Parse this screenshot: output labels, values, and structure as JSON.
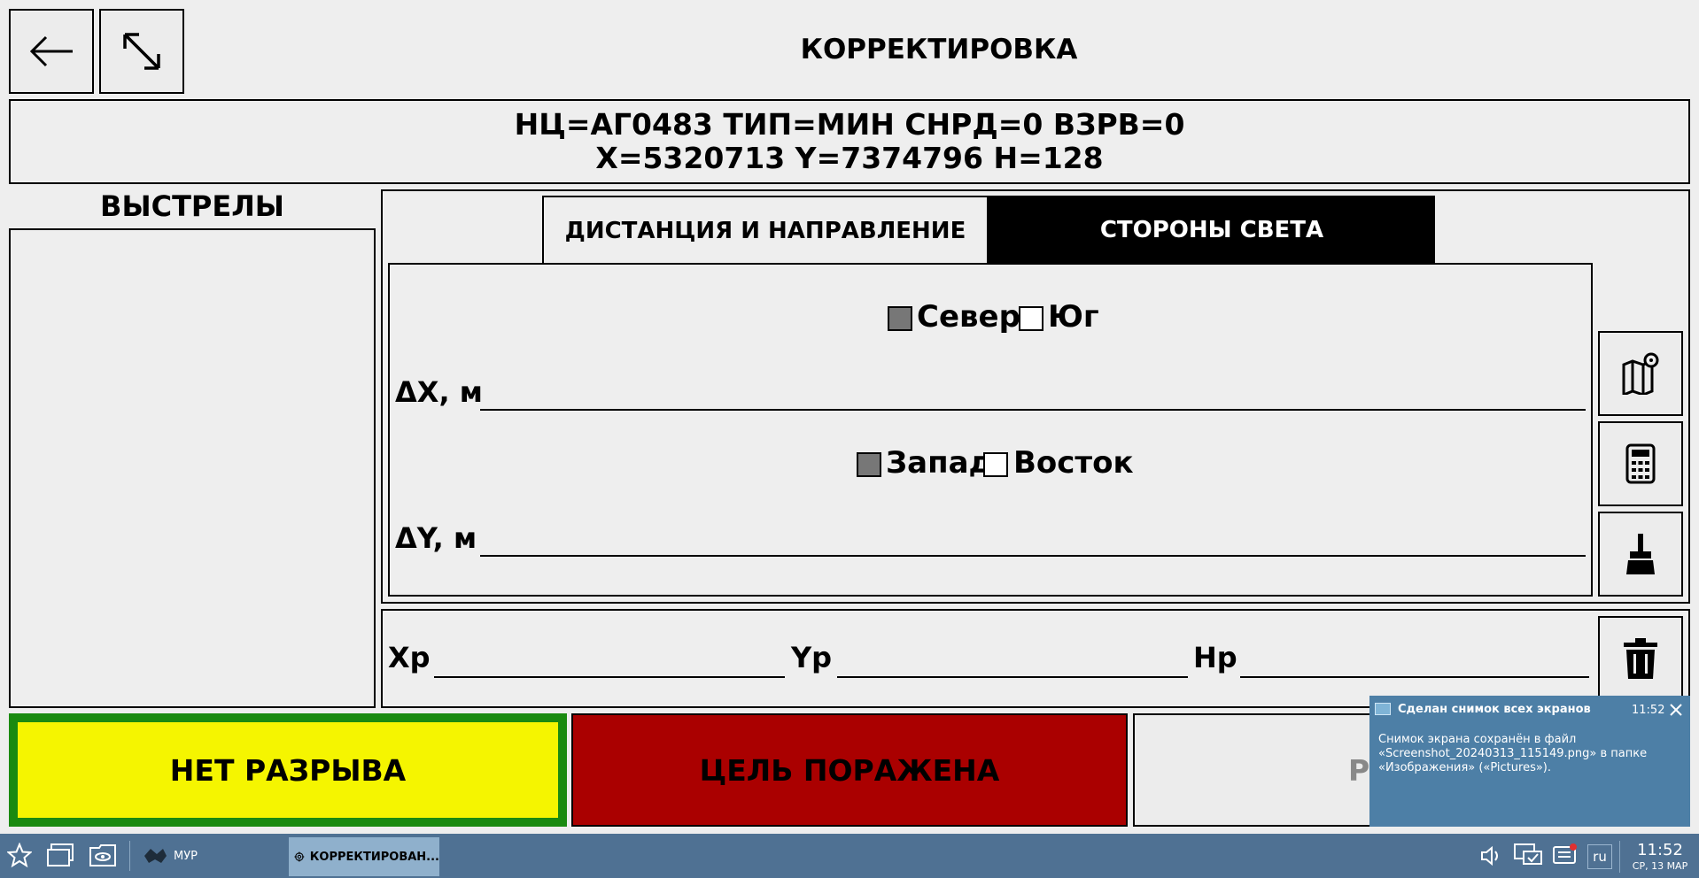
{
  "header": {
    "title": "КОРРЕКТИРОВКА"
  },
  "info": {
    "line1": "НЦ=АГ0483 ТИП=МИН СНРД=0 ВЗРВ=0",
    "line2": "X=5320713 Y=7374796 H=128"
  },
  "shots": {
    "title": "ВЫСТРЕЛЫ"
  },
  "tabs": [
    {
      "label": "ДИСТАНЦИЯ И НАПРАВЛЕНИЕ",
      "active": false
    },
    {
      "label": "СТОРОНЫ СВЕТА",
      "active": true
    }
  ],
  "compass": {
    "north_label": "Север",
    "north_checked": true,
    "south_label": "Юг",
    "south_checked": false,
    "dx_label": "ΔX, м",
    "west_label": "Запад",
    "west_checked": true,
    "east_label": "Восток",
    "east_checked": false,
    "dy_label": "ΔY, м"
  },
  "result": {
    "xr_label": "Хр",
    "yr_label": "Yр",
    "hr_label": "Нр"
  },
  "buttons": {
    "no_burst": "НЕТ РАЗРЫВА",
    "target_hit": "ЦЕЛЬ ПОРАЖЕНА",
    "third_partial": "Р"
  },
  "colors": {
    "no_burst_bg": "#f5f500",
    "no_burst_border": "#1a8a10",
    "target_hit_bg": "#aa0000",
    "active_tab_bg": "#000000"
  },
  "notification": {
    "title": "Сделан снимок всех экранов",
    "time": "11:52",
    "body": "Снимок экрана сохранён в файл «Screenshot_20240313_115149.png» в папке «Изображения» («Pictures»)."
  },
  "taskbar": {
    "app1": "МУР",
    "app2": "КОРРЕКТИРОВАН...",
    "lang": "ru",
    "clock_time": "11:52",
    "clock_date": "СР, 13 МАР"
  },
  "icons": [
    "back-arrow-icon",
    "expand-icon",
    "map-pin-icon",
    "calculator-icon",
    "broom-icon",
    "trash-icon",
    "star-icon",
    "windows-icon",
    "eye-folder-icon",
    "app-icon",
    "target-icon",
    "volume-icon",
    "network-icon",
    "notifications-icon",
    "close-icon"
  ]
}
